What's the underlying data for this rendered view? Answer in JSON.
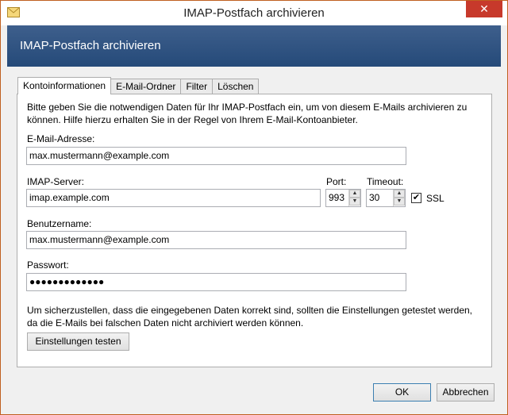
{
  "window": {
    "title": "IMAP-Postfach archivieren",
    "close_glyph": "✕",
    "icon": "envelope-icon"
  },
  "header": {
    "title": "IMAP-Postfach archivieren"
  },
  "tabs": [
    {
      "label": "Kontoinformationen",
      "active": true
    },
    {
      "label": "E-Mail-Ordner",
      "active": false
    },
    {
      "label": "Filter",
      "active": false
    },
    {
      "label": "Löschen",
      "active": false
    }
  ],
  "form": {
    "intro": "Bitte geben Sie die notwendigen Daten für Ihr IMAP-Postfach ein, um von diesem E-Mails archivieren zu können. Hilfe hierzu erhalten Sie in der Regel von Ihrem E-Mail-Kontoanbieter.",
    "email_label": "E-Mail-Adresse:",
    "email_value": "max.mustermann@example.com",
    "server_label": "IMAP-Server:",
    "server_value": "imap.example.com",
    "port_label": "Port:",
    "port_value": "993",
    "timeout_label": "Timeout:",
    "timeout_value": "30",
    "ssl_label": "SSL",
    "ssl_checked": true,
    "ssl_check_glyph": "✔",
    "user_label": "Benutzername:",
    "user_value": "max.mustermann@example.com",
    "password_label": "Passwort:",
    "password_value": "●●●●●●●●●●●●●",
    "test_note": "Um sicherzustellen, dass die eingegebenen Daten korrekt sind, sollten die Einstellungen getestet werden, da die E-Mails bei falschen Daten nicht archiviert werden können.",
    "test_button": "Einstellungen testen"
  },
  "footer": {
    "ok_label": "OK",
    "cancel_label": "Abbrechen"
  },
  "colors": {
    "banner": "#2f5584",
    "close": "#c7392b"
  }
}
